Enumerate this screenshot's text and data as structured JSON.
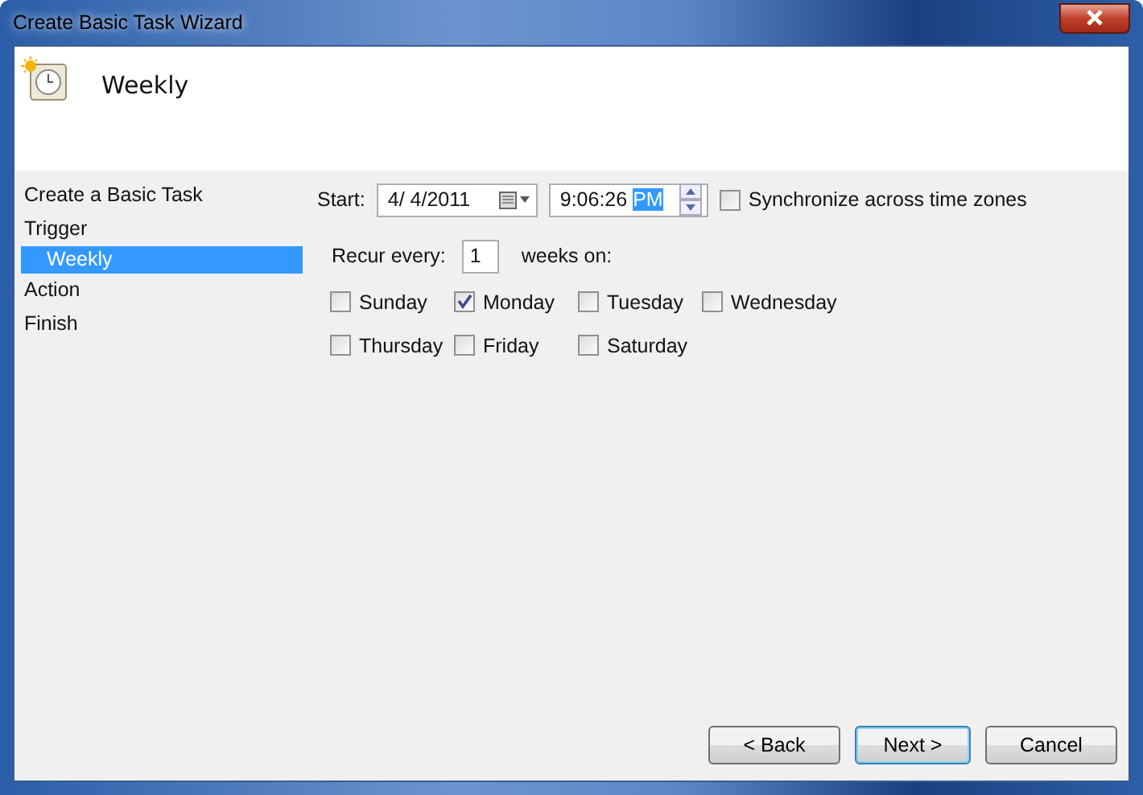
{
  "window": {
    "title": "Create Basic Task Wizard"
  },
  "header": {
    "title": "Weekly"
  },
  "steps": [
    {
      "label": "Create a Basic Task",
      "selected": false
    },
    {
      "label": "Trigger",
      "selected": false,
      "children": [
        {
          "label": "Weekly",
          "selected": true
        }
      ]
    },
    {
      "label": "Action",
      "selected": false
    },
    {
      "label": "Finish",
      "selected": false
    }
  ],
  "start": {
    "label": "Start:",
    "date": "4/  4/2011",
    "time": "9:06:26",
    "time_highlighted": "PM"
  },
  "sync": {
    "label": "Synchronize across time zones",
    "checked": false
  },
  "recur": {
    "label": "Recur every:",
    "value": "1",
    "suffix": "weeks on:"
  },
  "days": [
    {
      "label": "Sunday",
      "checked": false
    },
    {
      "label": "Monday",
      "checked": true
    },
    {
      "label": "Tuesday",
      "checked": false
    },
    {
      "label": "Wednesday",
      "checked": false
    },
    {
      "label": "Thursday",
      "checked": false
    },
    {
      "label": "Friday",
      "checked": false
    },
    {
      "label": "Saturday",
      "checked": false
    }
  ],
  "buttons": [
    {
      "label": "< Back",
      "default": false
    },
    {
      "label": "Next >",
      "default": true
    },
    {
      "label": "Cancel",
      "default": false
    }
  ]
}
